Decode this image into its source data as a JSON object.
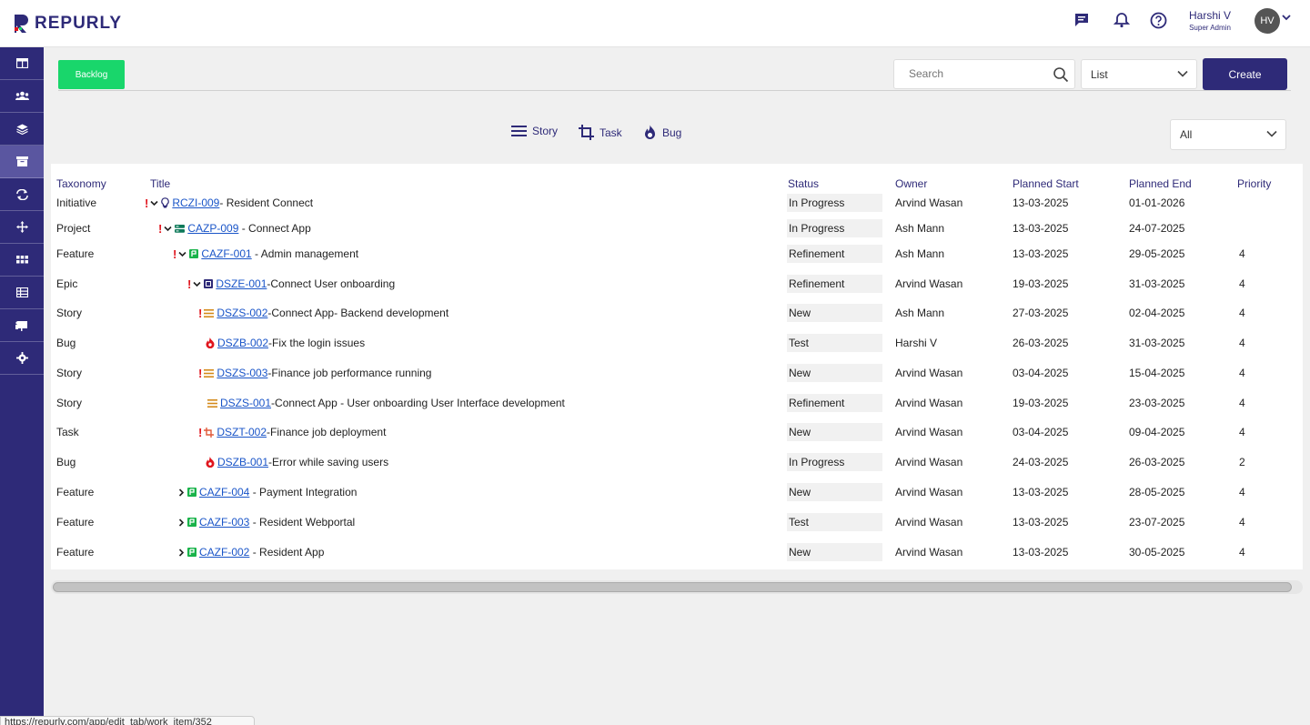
{
  "header": {
    "brand": "REPURLY",
    "user_name": "Harshi V",
    "user_role": "Super Admin",
    "avatar_initials": "HV"
  },
  "toolbar": {
    "backlog_label": "Backlog",
    "search_placeholder": "Search",
    "view_select": "List",
    "create_label": "Create",
    "filter_select": "All"
  },
  "filters": [
    {
      "label": "Story",
      "icon": "menu-lines-icon"
    },
    {
      "label": "Task",
      "icon": "crop-icon"
    },
    {
      "label": "Bug",
      "icon": "flame-icon"
    }
  ],
  "columns": {
    "taxonomy": "Taxonomy",
    "title": "Title",
    "status": "Status",
    "owner": "Owner",
    "planned_start": "Planned Start",
    "planned_end": "Planned End",
    "priority": "Priority"
  },
  "rows": [
    {
      "taxonomy": "Initiative",
      "code": " RCZI-009 ",
      "name": "- Resident Connect",
      "status": "In Progress",
      "owner": "Arvind Wasan",
      "start": "13-03-2025",
      "end": "01-01-2026",
      "priority": ""
    },
    {
      "taxonomy": "Project",
      "code": "CAZP-009",
      "name": " - Connect App",
      "status": "In Progress",
      "owner": "Ash Mann",
      "start": "13-03-2025",
      "end": "24-07-2025",
      "priority": ""
    },
    {
      "taxonomy": "Feature",
      "code": "CAZF-001",
      "name": " - Admin management",
      "status": "Refinement",
      "owner": "Ash Mann",
      "start": "13-03-2025",
      "end": "29-05-2025",
      "priority": "4"
    },
    {
      "taxonomy": "Epic",
      "code": "DSZE-001 ",
      "name": "-Connect User onboarding",
      "status": "Refinement",
      "owner": "Arvind Wasan",
      "start": "19-03-2025",
      "end": "31-03-2025",
      "priority": "4"
    },
    {
      "taxonomy": "Story",
      "code": "DSZS-002 ",
      "name": "-Connect App- Backend development",
      "status": "New",
      "owner": "Ash Mann",
      "start": "27-03-2025",
      "end": "02-04-2025",
      "priority": "4"
    },
    {
      "taxonomy": "Bug",
      "code": "DSZB-002 ",
      "name": "-Fix the login issues",
      "status": "Test",
      "owner": "Harshi V",
      "start": "26-03-2025",
      "end": "31-03-2025",
      "priority": "4"
    },
    {
      "taxonomy": "Story",
      "code": "DSZS-003 ",
      "name": "-Finance job performance running",
      "status": "New",
      "owner": "Arvind Wasan",
      "start": "03-04-2025",
      "end": "15-04-2025",
      "priority": "4"
    },
    {
      "taxonomy": "Story",
      "code": "DSZS-001 ",
      "name": "-Connect App - User onboarding User Interface development",
      "status": "Refinement",
      "owner": "Arvind Wasan",
      "start": "19-03-2025",
      "end": "23-03-2025",
      "priority": "4"
    },
    {
      "taxonomy": "Task",
      "code": "DSZT-002 ",
      "name": "-Finance job deployment",
      "status": "New",
      "owner": "Arvind Wasan",
      "start": "03-04-2025",
      "end": "09-04-2025",
      "priority": "4"
    },
    {
      "taxonomy": "Bug",
      "code": "DSZB-001 ",
      "name": "-Error while saving users",
      "status": "In Progress",
      "owner": "Arvind Wasan",
      "start": "24-03-2025",
      "end": "26-03-2025",
      "priority": "2"
    },
    {
      "taxonomy": "Feature",
      "code": "CAZF-004",
      "name": " - Payment Integration",
      "status": "New",
      "owner": "Arvind Wasan",
      "start": "13-03-2025",
      "end": "28-05-2025",
      "priority": "4"
    },
    {
      "taxonomy": "Feature",
      "code": "CAZF-003",
      "name": " - Resident Webportal",
      "status": "Test",
      "owner": "Arvind Wasan",
      "start": "13-03-2025",
      "end": "23-07-2025",
      "priority": "4"
    },
    {
      "taxonomy": "Feature",
      "code": "CAZF-002",
      "name": " - Resident App",
      "status": "New",
      "owner": "Arvind Wasan",
      "start": "13-03-2025",
      "end": "30-05-2025",
      "priority": "4"
    }
  ],
  "status_bar_url": "https://repurly.com/app/edit_tab/work_item/352",
  "colors": {
    "brand": "#2e2a78",
    "accent_green": "#19d66b",
    "link": "#1a55c8",
    "priority_flag": "#e0161e"
  }
}
